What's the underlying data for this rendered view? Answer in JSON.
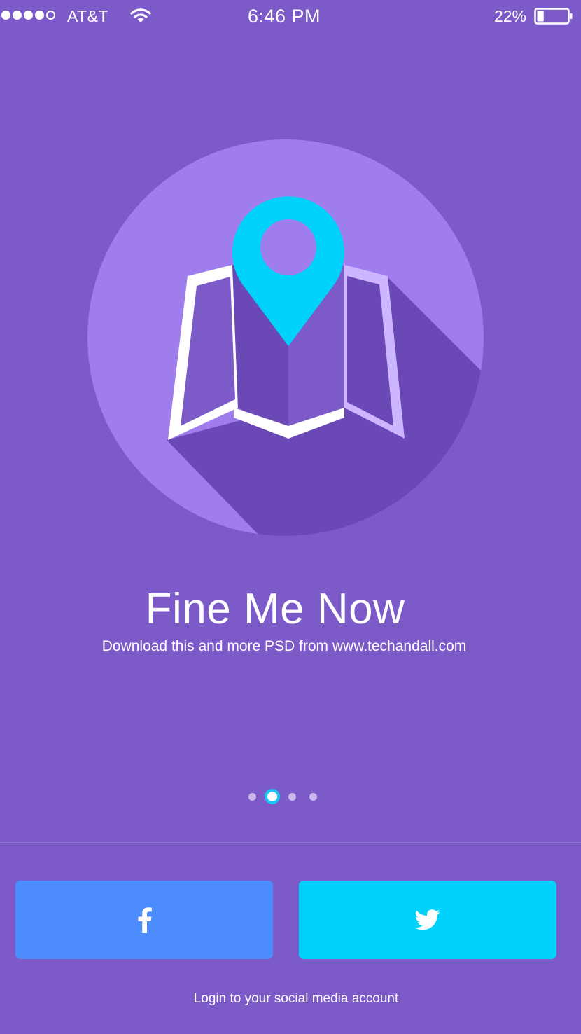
{
  "status_bar": {
    "carrier": "AT&T",
    "time": "6:46 PM",
    "battery_percent": "22%",
    "signal_bars_filled": 4,
    "signal_bars_total": 5,
    "battery_level": 0.22
  },
  "onboarding": {
    "title": "Fine Me Now",
    "subtitle": "Download this and more PSD from www.techandall.com",
    "illustration": "map-pin-icon",
    "pager": {
      "total": 4,
      "active_index": 1
    }
  },
  "social_login": {
    "facebook_icon": "facebook-icon",
    "twitter_icon": "twitter-icon",
    "hint": "Login to your social media account"
  },
  "colors": {
    "background": "#7c5ac8",
    "circle": "#a07dec",
    "shadow": "#6a48b6",
    "pin": "#00d2fc",
    "facebook": "#4d8cfd",
    "twitter": "#00d2fc",
    "pager_active_ring": "#19c6f5"
  }
}
